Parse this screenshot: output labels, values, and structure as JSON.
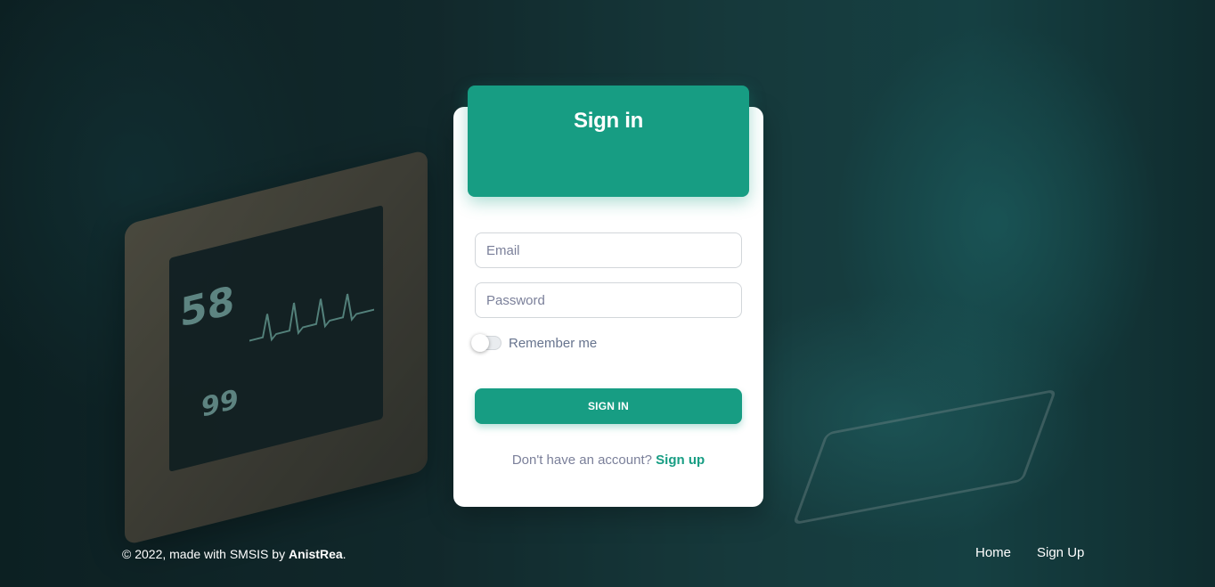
{
  "card": {
    "title": "Sign in"
  },
  "form": {
    "email_placeholder": "Email",
    "password_placeholder": "Password",
    "remember_label": "Remember me",
    "remember_checked": false,
    "submit_label": "SIGN IN"
  },
  "signup_prompt": {
    "text": "Don't have an account?",
    "link_label": "Sign up"
  },
  "footer": {
    "copyright_prefix": "© 2022, made with SMSIS by ",
    "author": "AnistRea",
    "copyright_suffix": ".",
    "nav": [
      {
        "label": "Home"
      },
      {
        "label": "Sign Up"
      }
    ]
  },
  "background": {
    "monitor_value_1": "58",
    "monitor_value_2": "99"
  },
  "colors": {
    "accent": "#179d83",
    "card_bg": "#ffffff",
    "muted_text": "#7b809a"
  }
}
